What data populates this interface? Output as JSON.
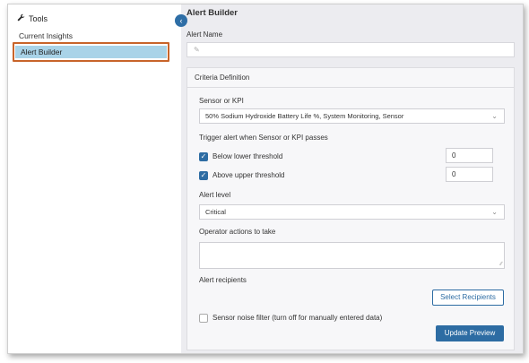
{
  "sidebar": {
    "tools_label": "Tools",
    "tools_icon": "wrench-icon",
    "items": [
      {
        "label": "Current Insights"
      },
      {
        "label": "Alert Builder"
      }
    ]
  },
  "main": {
    "title": "Alert Builder",
    "alert_name_label": "Alert Name",
    "alert_name_value": "",
    "criteria": {
      "header": "Criteria Definition",
      "sensor_label": "Sensor or KPI",
      "sensor_value": "50% Sodium Hydroxide Battery Life %, System Monitoring, Sensor",
      "trigger_label": "Trigger alert when Sensor or KPI passes",
      "below": {
        "label": "Below lower threshold",
        "checked": true,
        "value": "0"
      },
      "above": {
        "label": "Above upper threshold",
        "checked": true,
        "value": "0"
      },
      "level_label": "Alert level",
      "level_value": "Critical",
      "operator_label": "Operator actions to take",
      "operator_value": "",
      "recipients_label": "Alert recipients",
      "select_recipients_button": "Select Recipients",
      "noise_filter": {
        "label": "Sensor noise filter (turn off for manually entered data)",
        "checked": false
      },
      "update_button": "Update Preview"
    }
  },
  "colors": {
    "accent": "#2d6ca3",
    "highlight": "#a9d3e8",
    "focus_border": "#c8642a"
  }
}
